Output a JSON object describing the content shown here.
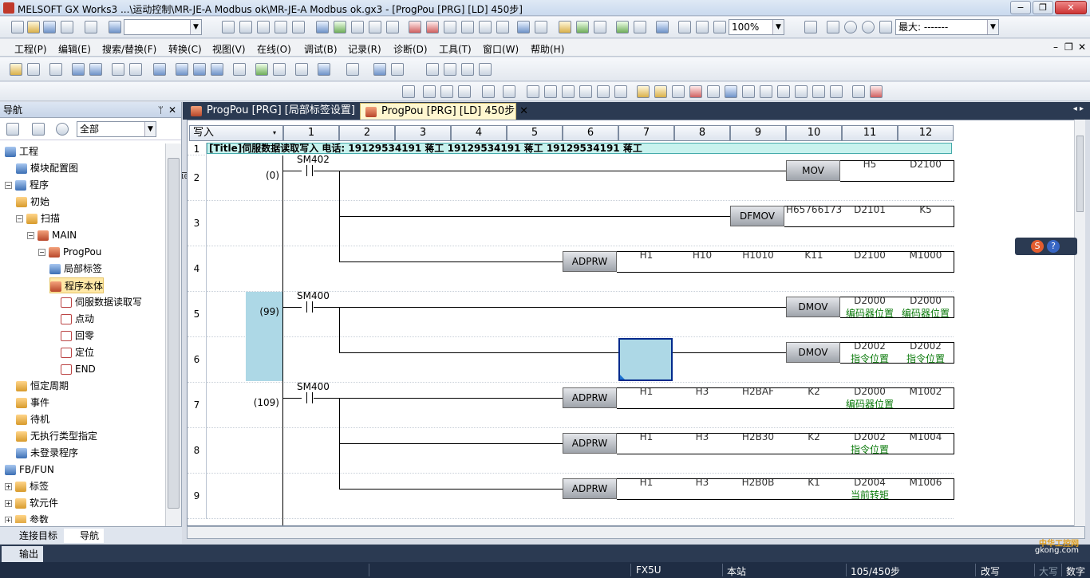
{
  "window": {
    "title": "MELSOFT GX Works3 ...\\运动控制\\MR-JE-A  Modbus ok\\MR-JE-A  Modbus ok.gx3 - [ProgPou [PRG] [LD] 450步]",
    "minimize": "−",
    "restore": "❐",
    "close": "✕"
  },
  "toolbar1": {
    "zoom": "100%",
    "max_label": "最大: -------"
  },
  "menu": {
    "items": [
      "工程(P)",
      "编辑(E)",
      "搜索/替换(F)",
      "转换(C)",
      "视图(V)",
      "在线(O)",
      "调试(B)",
      "记录(R)",
      "诊断(D)",
      "工具(T)",
      "窗口(W)",
      "帮助(H)"
    ],
    "controls": [
      "–",
      "❐",
      "✕"
    ]
  },
  "ladder_keys": [
    {
      "key": "F5"
    },
    {
      "key": "sF5"
    },
    {
      "key": "F6"
    },
    {
      "key": "sF6"
    },
    {
      "key": "F7"
    },
    {
      "key": "F8"
    },
    {
      "key": "F9"
    },
    {
      "key": "sF9"
    },
    {
      "key": "cF9"
    },
    {
      "key": "cF10"
    },
    {
      "key": "sF7"
    },
    {
      "key": "sF8"
    },
    {
      "key": "aF7"
    },
    {
      "key": "aF8"
    },
    {
      "key": "saF5"
    },
    {
      "key": "saF6"
    },
    {
      "key": "saF7"
    },
    {
      "key": "saF8"
    },
    {
      "key": "aF5"
    },
    {
      "key": "caF5"
    },
    {
      "key": "caF10"
    }
  ],
  "nav": {
    "title": "导航",
    "pin": "ᛘ",
    "close": "✕",
    "filter": "全部",
    "tree": [
      {
        "label": "工程",
        "level": 0,
        "toggle": "",
        "icon": "blu"
      },
      {
        "label": "模块配置图",
        "level": 1,
        "toggle": "",
        "icon": "blu"
      },
      {
        "label": "程序",
        "level": 0,
        "toggle": "−",
        "icon": "blu"
      },
      {
        "label": "初始",
        "level": 1,
        "toggle": "",
        "icon": "fold"
      },
      {
        "label": "扫描",
        "level": 1,
        "toggle": "−",
        "icon": "fold"
      },
      {
        "label": "MAIN",
        "level": 2,
        "toggle": "−",
        "icon": "prg"
      },
      {
        "label": "ProgPou",
        "level": 3,
        "toggle": "−",
        "icon": "prg"
      },
      {
        "label": "局部标签",
        "level": 4,
        "toggle": "",
        "icon": "blu"
      },
      {
        "label": "程序本体",
        "level": 4,
        "toggle": "",
        "icon": "prg",
        "selected": true
      },
      {
        "label": "伺服数据读取写",
        "level": 5,
        "toggle": "",
        "icon": "doc"
      },
      {
        "label": "点动",
        "level": 5,
        "toggle": "",
        "icon": "doc"
      },
      {
        "label": "回零",
        "level": 5,
        "toggle": "",
        "icon": "doc"
      },
      {
        "label": "定位",
        "level": 5,
        "toggle": "",
        "icon": "doc"
      },
      {
        "label": "END",
        "level": 5,
        "toggle": "",
        "icon": "doc"
      },
      {
        "label": "恒定周期",
        "level": 1,
        "toggle": "",
        "icon": "fold"
      },
      {
        "label": "事件",
        "level": 1,
        "toggle": "",
        "icon": "fold"
      },
      {
        "label": "待机",
        "level": 1,
        "toggle": "",
        "icon": "fold"
      },
      {
        "label": "无执行类型指定",
        "level": 1,
        "toggle": "",
        "icon": "fold"
      },
      {
        "label": "未登录程序",
        "level": 1,
        "toggle": "",
        "icon": "blu"
      },
      {
        "label": "FB/FUN",
        "level": 0,
        "toggle": "",
        "icon": "blu"
      },
      {
        "label": "标签",
        "level": 0,
        "toggle": "+",
        "icon": "fold"
      },
      {
        "label": "软元件",
        "level": 0,
        "toggle": "+",
        "icon": "fold"
      },
      {
        "label": "参数",
        "level": 0,
        "toggle": "+",
        "icon": "fold"
      }
    ],
    "bottom_tabs": [
      "连接目标",
      "导航"
    ]
  },
  "output_tab": "输出",
  "tabs": [
    {
      "label": "ProgPou [PRG] [局部标签设置]"
    },
    {
      "label": "ProgPou [PRG] [LD] 450步",
      "close": "✕"
    }
  ],
  "tab_arrows": "◂ ▸",
  "editor": {
    "mode": "写入",
    "columns": [
      "1",
      "2",
      "3",
      "4",
      "5",
      "6",
      "7",
      "8",
      "9",
      "10",
      "11",
      "12"
    ],
    "title_comment": "[Title]伺服数据读取写入 电话:  19129534191 蒋工 19129534191 蒋工 19129534191 蒋工",
    "rows": [
      "1",
      "2",
      "3",
      "4",
      "5",
      "6",
      "7",
      "8",
      "9"
    ],
    "steps": [
      "(0)",
      "(99)",
      "(109)"
    ],
    "contacts": [
      "SM402",
      "SM400",
      "SM400"
    ],
    "instructions": [
      {
        "name": "MOV",
        "operands": [
          "H5",
          "D2100"
        ],
        "comments": [
          "",
          ""
        ]
      },
      {
        "name": "DFMOV",
        "operands": [
          "H65766173",
          "D2101",
          "K5"
        ],
        "comments": [
          "",
          "",
          ""
        ]
      },
      {
        "name": "ADPRW",
        "operands": [
          "H1",
          "H10",
          "H1010",
          "K11",
          "D2100",
          "M1000"
        ],
        "comments": [
          "",
          "",
          "",
          "",
          "",
          ""
        ]
      },
      {
        "name": "DMOV",
        "operands": [
          "D2000",
          "D2000"
        ],
        "comments": [
          "编码器位置",
          "编码器位置"
        ]
      },
      {
        "name": "DMOV",
        "operands": [
          "D2002",
          "D2002"
        ],
        "comments": [
          "指令位置",
          "指令位置"
        ]
      },
      {
        "name": "ADPRW",
        "operands": [
          "H1",
          "H3",
          "H2BAF",
          "K2",
          "D2000",
          "M1002"
        ],
        "comments": [
          "",
          "",
          "",
          "",
          "编码器位置",
          ""
        ]
      },
      {
        "name": "ADPRW",
        "operands": [
          "H1",
          "H3",
          "H2B30",
          "K2",
          "D2002",
          "M1004"
        ],
        "comments": [
          "",
          "",
          "",
          "",
          "指令位置",
          ""
        ]
      },
      {
        "name": "ADPRW",
        "operands": [
          "H1",
          "H3",
          "H2B0B",
          "K1",
          "D2004",
          "M1006"
        ],
        "comments": [
          "",
          "",
          "",
          "",
          "当前转矩",
          ""
        ]
      }
    ]
  },
  "status": {
    "cpu": "FX5U",
    "station": "本站",
    "steps": "105/450步",
    "mode": "改写",
    "caps": "大写",
    "num": "数字"
  },
  "watermark": {
    "line1": "中华工控网",
    "line2": "gkong.com"
  }
}
